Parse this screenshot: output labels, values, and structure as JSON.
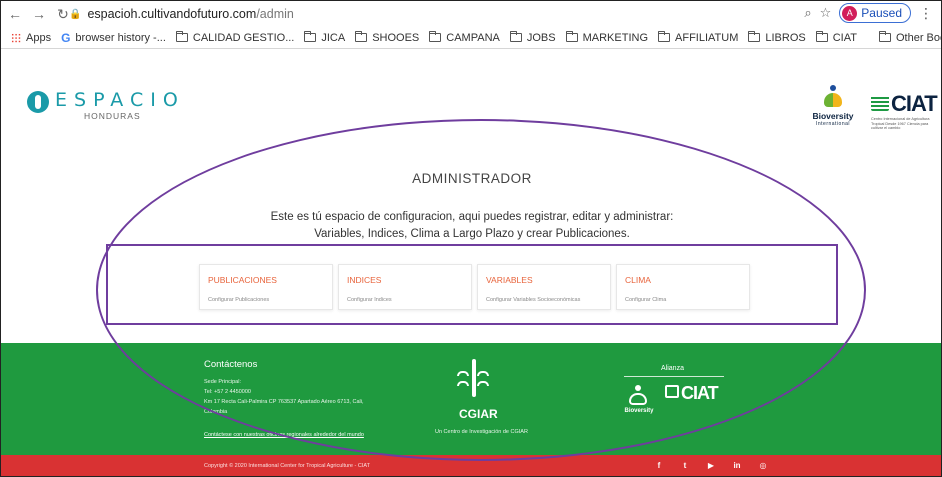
{
  "browser": {
    "url_host": "espacioh.cultivandofuturo.com",
    "url_path": "/admin",
    "profile_initial": "A",
    "profile_status": "Paused",
    "bookmarks": [
      {
        "label": "Apps",
        "icon": "apps-grid-icon"
      },
      {
        "label": "browser history -...",
        "icon": "google-icon"
      },
      {
        "label": "CALIDAD GESTIO...",
        "icon": "folder-icon"
      },
      {
        "label": "JICA",
        "icon": "folder-icon"
      },
      {
        "label": "SHOOES",
        "icon": "folder-icon"
      },
      {
        "label": "CAMPANA",
        "icon": "folder-icon"
      },
      {
        "label": "JOBS",
        "icon": "folder-icon"
      },
      {
        "label": "MARKETING",
        "icon": "folder-icon"
      },
      {
        "label": "AFFILIATUM",
        "icon": "folder-icon"
      },
      {
        "label": "LIBROS",
        "icon": "folder-icon"
      },
      {
        "label": "CIAT",
        "icon": "folder-icon"
      }
    ],
    "other_bookmarks": "Other Bookmarks"
  },
  "header": {
    "logo_word": "ESPACIO",
    "logo_sub": "HONDURAS",
    "partner1_name": "Bioversity",
    "partner1_sub": "International",
    "partner2_name": "CIAT",
    "partner2_sub": "Centro Internacional de Agricultura Tropical Desde 1967 Ciencia para cultivar el cambio"
  },
  "admin": {
    "title": "ADMINISTRADOR",
    "intro_line1": "Este es tú espacio de configuracion, aqui puedes registrar, editar y administrar:",
    "intro_line2": "Variables, Indices, Clima a Largo Plazo y crear Publicaciones.",
    "cards": [
      {
        "title": "PUBLICACIONES",
        "sub": "Configurar Publicaciones"
      },
      {
        "title": "INDICES",
        "sub": "Configurar Indices"
      },
      {
        "title": "VARIABLES",
        "sub": "Configurar Variables Socioeconómicas"
      },
      {
        "title": "CLIMA",
        "sub": "Configurar Clima"
      }
    ]
  },
  "footer": {
    "contact_title": "Contáctenos",
    "contact_lines": [
      "Sede Principal:",
      "Tel: +57 2 4450000",
      "Km 17 Recta Cali-Palmira CP 763537 Apartado Aéreo 6713, Cali,",
      "Colombia"
    ],
    "contact_link": "Contáctese con nuestras oficinas regionales alrededor del mundo",
    "cgiar_name": "CGIAR",
    "cgiar_sub": "Un Centro de Investigación de CGIAR",
    "alianza_title": "Alianza",
    "alianza_biov": "Bioversity",
    "alianza_ciat": "CIAT",
    "copyright": "Copyright © 2020 International Center for Tropical Agriculture - CIAT",
    "social": [
      {
        "icon": "facebook-icon",
        "glyph": "f"
      },
      {
        "icon": "twitter-icon",
        "glyph": "t"
      },
      {
        "icon": "youtube-icon",
        "glyph": "▶"
      },
      {
        "icon": "linkedin-icon",
        "glyph": "in"
      },
      {
        "icon": "instagram-icon",
        "glyph": "◎"
      }
    ]
  },
  "colors": {
    "brand_teal": "#1a9aa8",
    "card_title": "#e8643c",
    "footer_green": "#1f9a3f",
    "footer_red": "#d93233",
    "annotation": "#6f3d9e"
  }
}
